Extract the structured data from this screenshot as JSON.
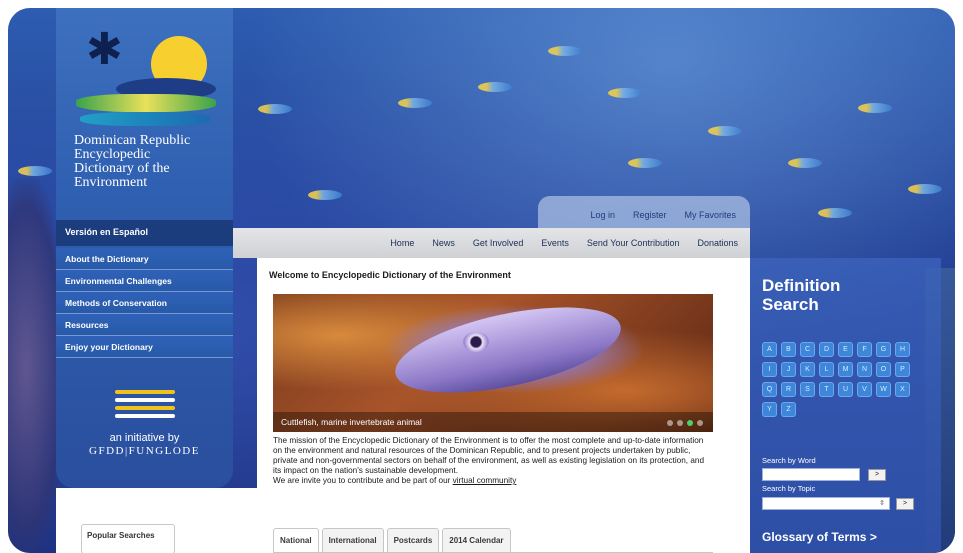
{
  "site": {
    "title_lines": [
      "Dominican Republic",
      "Encyclopedic",
      "Dictionary of the",
      "Environment"
    ]
  },
  "lang_link": "Versión en Español",
  "side_nav": [
    "About the Dictionary",
    "Environmental Challenges",
    "Methods of Conservation",
    "Resources",
    "Enjoy your Dictionary"
  ],
  "initiative": {
    "by": "an initiative by",
    "org": "GFDD|FUNGLODE"
  },
  "user_links": [
    "Log in",
    "Register",
    "My Favorites"
  ],
  "top_nav": [
    "Home",
    "News",
    "Get Involved",
    "Events",
    "Send Your Contribution",
    "Donations"
  ],
  "main": {
    "welcome": "Welcome to Encyclopedic Dictionary of the Environment",
    "hero_caption": "Cuttlefish, marine invertebrate animal",
    "mission": "The mission of the Encyclopedic Dictionary of the Environment is to offer the most complete and up-to-date information on the environment and natural resources of the Dominican Republic, and to present projects undertaken by public, private and non-governmental sectors on behalf of the environment, as well as existing legislation on its protection, and its impact on the nation's sustainable development.",
    "invite_prefix": "We are invite you to contribute and be part of our",
    "invite_link": "virtual community",
    "tabs": [
      "National",
      "International",
      "Postcards",
      "2014 Calendar"
    ]
  },
  "popular_searches": "Popular Searches",
  "definition_search": {
    "title_line1": "Definition",
    "title_line2": "Search",
    "letters": [
      "A",
      "B",
      "C",
      "D",
      "E",
      "F",
      "G",
      "H",
      "I",
      "J",
      "K",
      "L",
      "M",
      "N",
      "O",
      "P",
      "Q",
      "R",
      "S",
      "T",
      "U",
      "V",
      "W",
      "X",
      "Y",
      "Z"
    ],
    "search_by_word": "Search by Word",
    "search_by_topic": "Search by Topic",
    "go_label": ">",
    "select_arrow": "⇳",
    "glossary": "Glossary of Terms >"
  }
}
